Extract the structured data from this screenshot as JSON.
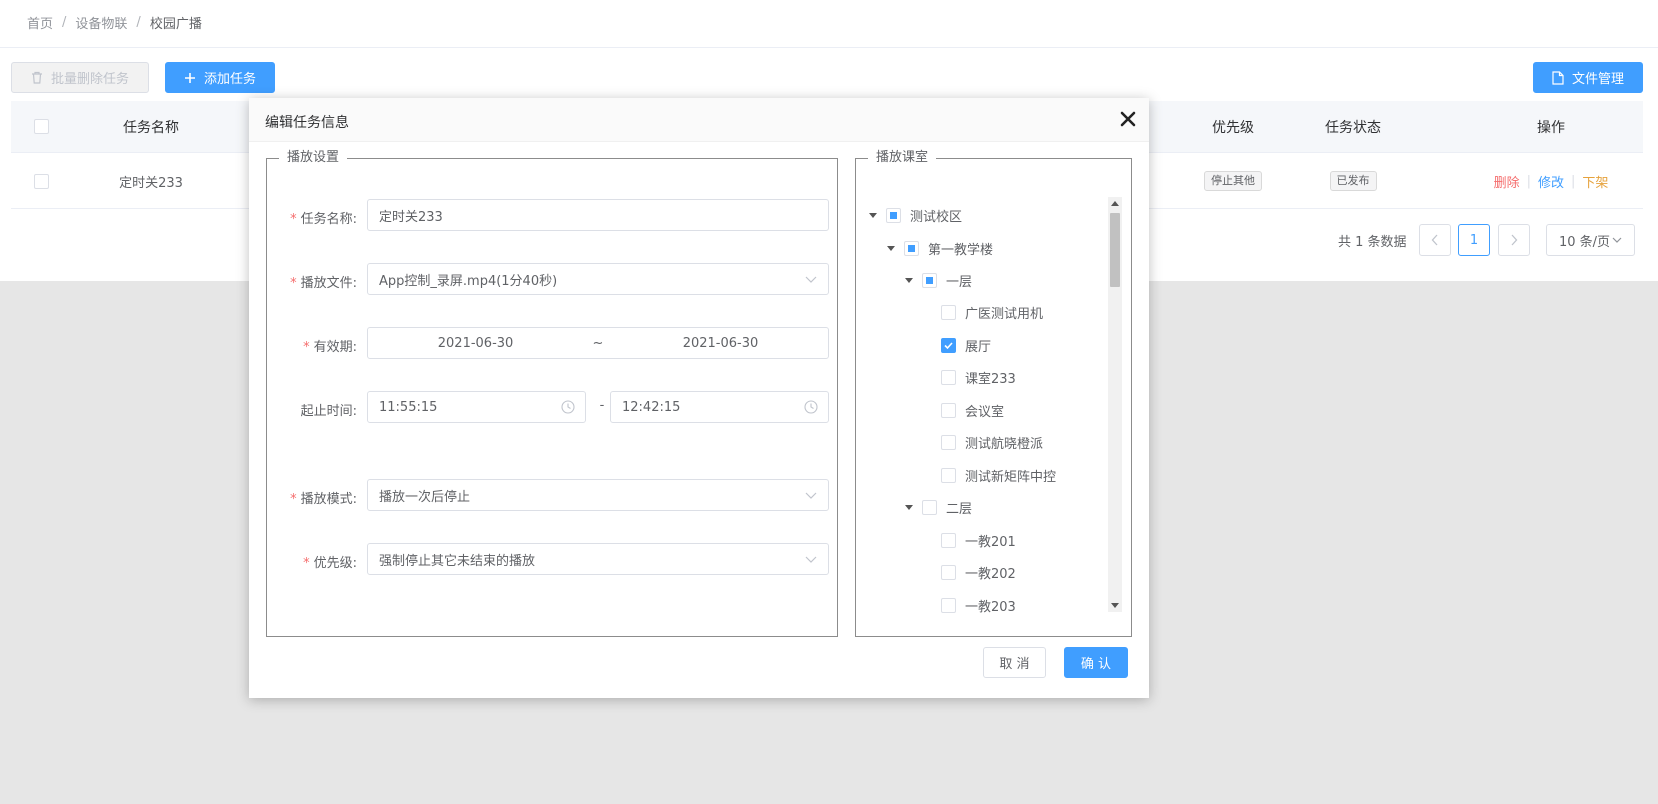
{
  "breadcrumb": {
    "home": "首页",
    "device": "设备物联",
    "current": "校园广播",
    "sep": "/"
  },
  "toolbar": {
    "batch_delete": "批量删除任务",
    "add_task": "添加任务",
    "file_manage": "文件管理"
  },
  "table": {
    "columns": {
      "name": "任务名称",
      "priority": "优先级",
      "status": "任务状态",
      "actions": "操作"
    },
    "rows": [
      {
        "name": "定时关233",
        "priority": "停止其他",
        "status": "已发布",
        "actions": {
          "delete": "删除",
          "edit": "修改",
          "off": "下架",
          "sep": "|"
        }
      }
    ]
  },
  "pagination": {
    "total": "共 1 条数据",
    "current_page": "1",
    "page_size": "10 条/页"
  },
  "dialog": {
    "title": "编辑任务信息",
    "play_settings": {
      "legend": "播放设置",
      "task_name_label": "任务名称:",
      "task_name_value": "定时关233",
      "file_label": "播放文件:",
      "file_value": "App控制_录屏.mp4(1分40秒)",
      "validity_label": "有效期:",
      "validity_start": "2021-06-30",
      "validity_sep": "~",
      "validity_end": "2021-06-30",
      "time_label": "起止时间:",
      "time_start": "11:55:15",
      "time_sep": "-",
      "time_end": "12:42:15",
      "mode_label": "播放模式:",
      "mode_value": "播放一次后停止",
      "priority_label": "优先级:",
      "priority_value": "强制停止其它未结束的播放",
      "required_mark": "*"
    },
    "classrooms": {
      "legend": "播放课室",
      "tree": {
        "campus": "测试校区",
        "building": "第一教学楼",
        "floor1": "一层",
        "floor1_rooms": [
          "广医测试用机",
          "展厅",
          "课室233",
          "会议室",
          "测试航晓橙派",
          "测试新矩阵中控"
        ],
        "floor2": "二层",
        "floor2_rooms": [
          "一教201",
          "一教202",
          "一教203"
        ]
      }
    },
    "cancel": "取 消",
    "confirm": "确 认"
  },
  "colors": {
    "primary": "#409eff",
    "danger": "#f56c6c",
    "warning": "#e6a23c",
    "mask": "#e6e6e6"
  }
}
